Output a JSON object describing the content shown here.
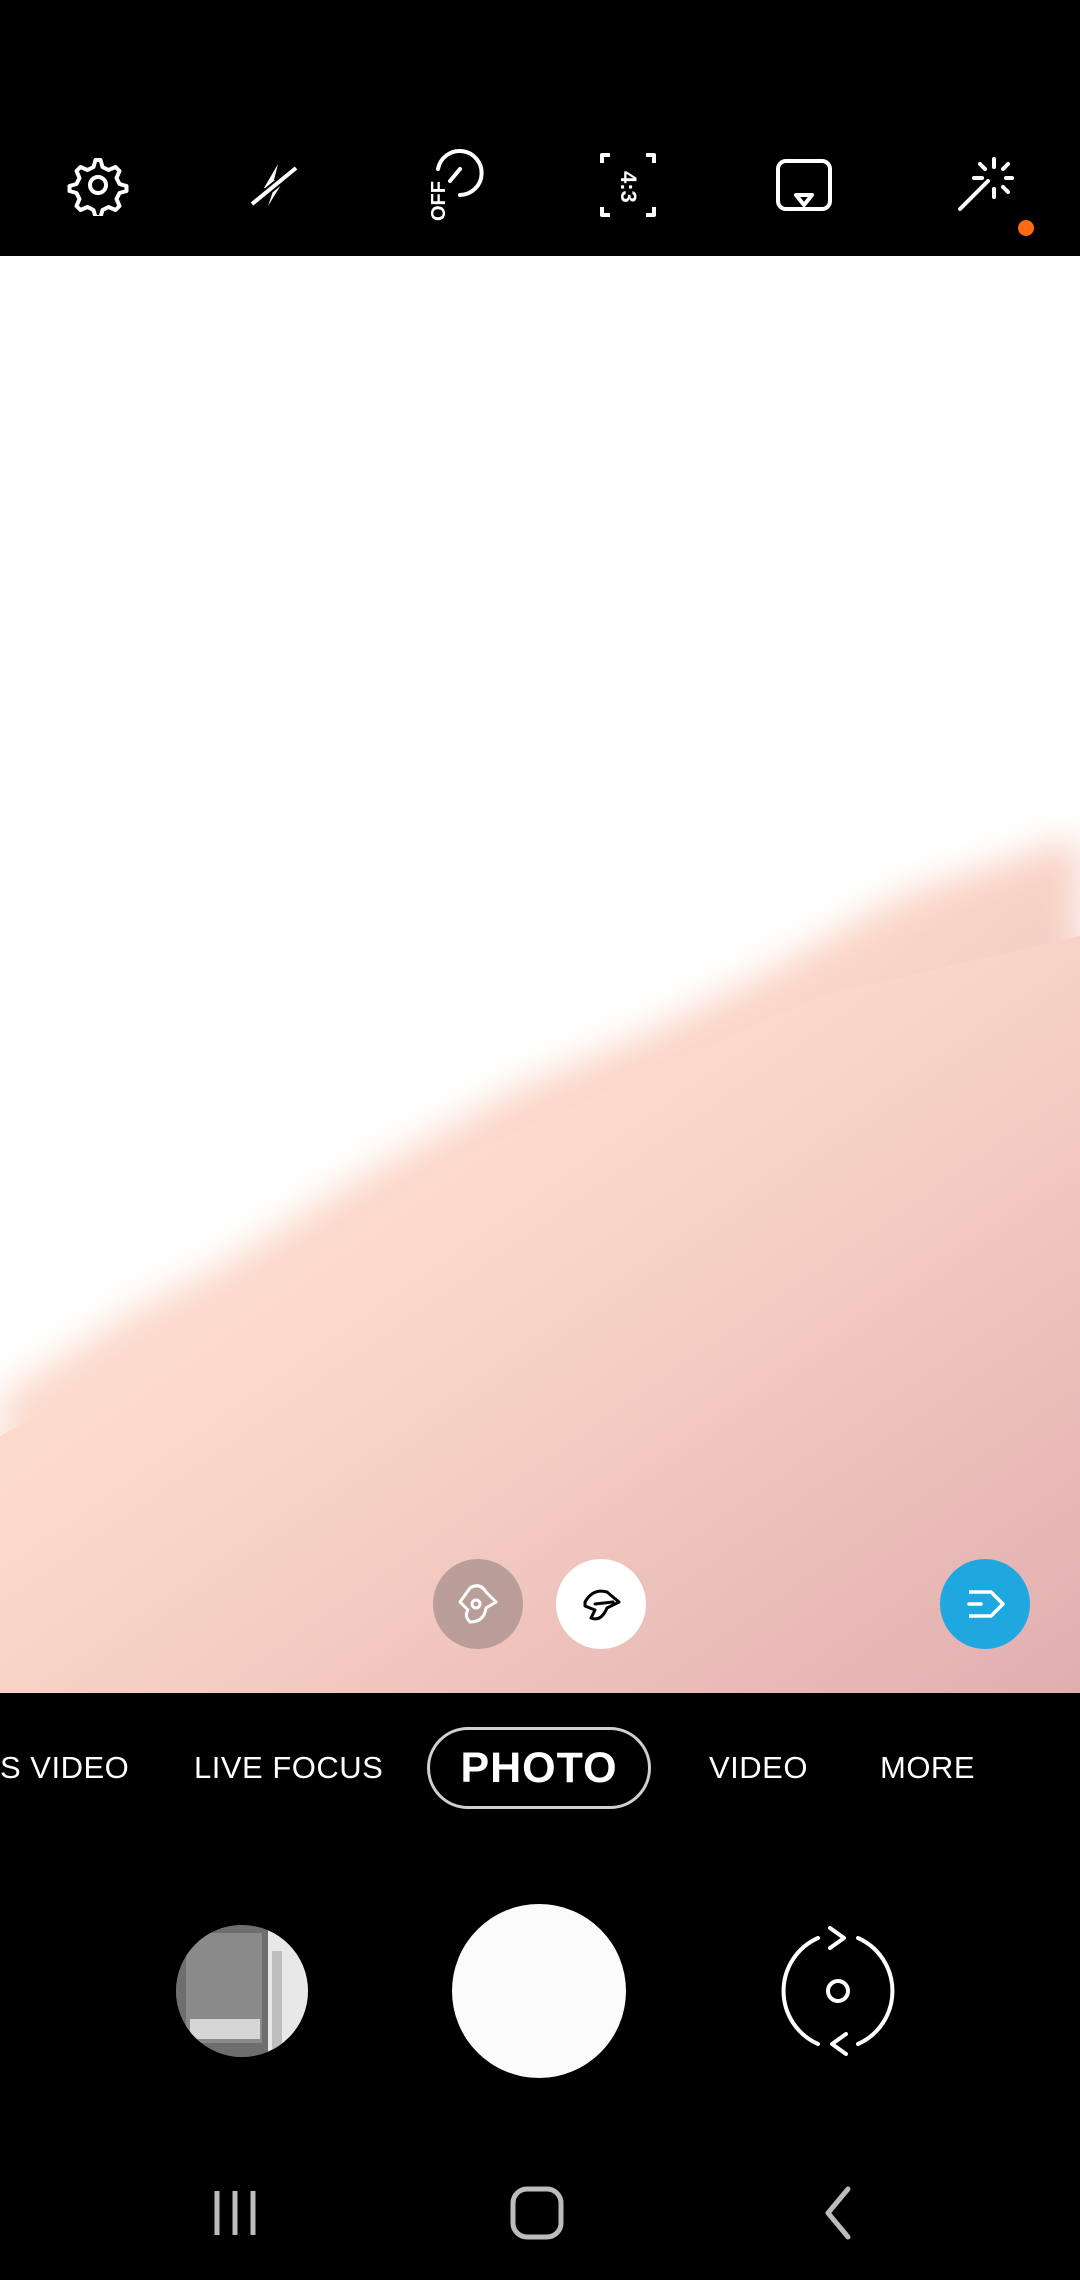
{
  "top_bar": {
    "icons": [
      "settings-icon",
      "flash-off-icon",
      "timer-off-icon",
      "aspect-ratio-icon",
      "motion-photo-icon",
      "filters-effects-icon"
    ],
    "timer_label": "OFF",
    "ratio_label": "4:3",
    "notification_color": "#ff6a13"
  },
  "viewfinder": {
    "icons": [
      "scene-optimizer-icon",
      "scene-optimizer-active-icon",
      "bixby-vision-icon"
    ],
    "accent": "#1fa7e0"
  },
  "modes": {
    "items": [
      "S VIDEO",
      "LIVE FOCUS",
      "PHOTO",
      "VIDEO",
      "MORE"
    ],
    "active": "PHOTO"
  },
  "controls": {
    "icons": [
      "gallery-thumbnail",
      "shutter-button",
      "switch-camera-icon"
    ]
  },
  "nav_bar": {
    "icons": [
      "recent-apps-icon",
      "home-icon",
      "back-icon"
    ]
  }
}
